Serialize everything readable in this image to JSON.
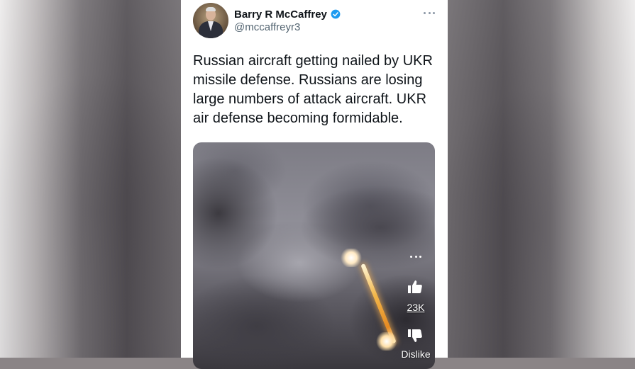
{
  "tweet": {
    "author_name": "Barry R McCaffrey",
    "author_handle": "@mccaffreyr3",
    "verified": true,
    "text": "Russian aircraft getting nailed by UKR missile defense. Russians are losing large numbers of attack aircraft. UKR air defense becoming formidable."
  },
  "video_overlay": {
    "like_count": "23K",
    "dislike_label": "Dislike"
  },
  "colors": {
    "verified_badge": "#1d9bf0",
    "name_text": "#0f1419",
    "handle_text": "#536471",
    "overlay_text": "#ffffff"
  },
  "icons": {
    "verified": "verified-badge-icon",
    "more": "more-options-icon",
    "video_menu": "video-menu-icon",
    "like": "thumbs-up-icon",
    "dislike": "thumbs-down-icon"
  }
}
